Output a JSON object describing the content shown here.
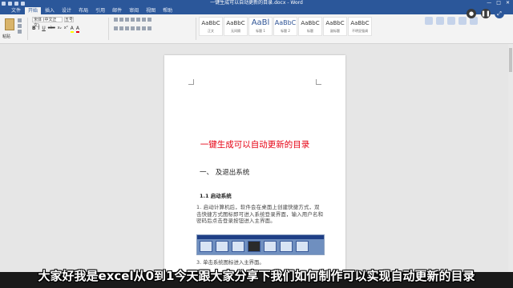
{
  "window": {
    "title": "一键生成可以自动更新的目录.docx - Word",
    "controls": [
      "—",
      "□",
      "✕"
    ]
  },
  "ribbon": {
    "tabs": [
      "文件",
      "开始",
      "插入",
      "设计",
      "布局",
      "引用",
      "邮件",
      "审阅",
      "视图",
      "帮助"
    ],
    "active_tab": "开始",
    "paste_label": "粘贴",
    "font_name": "宋体 (中文正文)",
    "font_size": "五号",
    "format_buttons": [
      "B",
      "I",
      "U",
      "abc",
      "x₂",
      "x²",
      "A",
      "A"
    ],
    "styles": [
      {
        "preview": "AaBbC",
        "name": "正文",
        "kind": "normal"
      },
      {
        "preview": "AaBbC",
        "name": "无间隔",
        "kind": "normal"
      },
      {
        "preview": "AaBl",
        "name": "标题 1",
        "kind": "big"
      },
      {
        "preview": "AaBbC",
        "name": "标题 2",
        "kind": "med"
      },
      {
        "preview": "AaBbC",
        "name": "标题",
        "kind": "normal"
      },
      {
        "preview": "AaBbC",
        "name": "副标题",
        "kind": "normal"
      },
      {
        "preview": "AaBbC",
        "name": "不明显强调",
        "kind": "normal"
      }
    ]
  },
  "document": {
    "title": "一键生成可以自动更新的目录",
    "heading1": "一、 及退出系统",
    "heading2": "1.1  启动系统",
    "paragraph": "1. 启动计算机后，软件会在桌面上创建快捷方式，双击快捷方式图标即可进入系统登录界面，输入用户名和密码后点击登录按钮进入主界面。",
    "paragraph2": "3. 单击系统图标进入主界面。"
  },
  "colors": {
    "title_red": "#e60012",
    "word_blue": "#2b579a"
  },
  "subtitle": "大家好我是excel从0到1今天跟大家分享下我们如何制作可以实现自动更新的目录"
}
